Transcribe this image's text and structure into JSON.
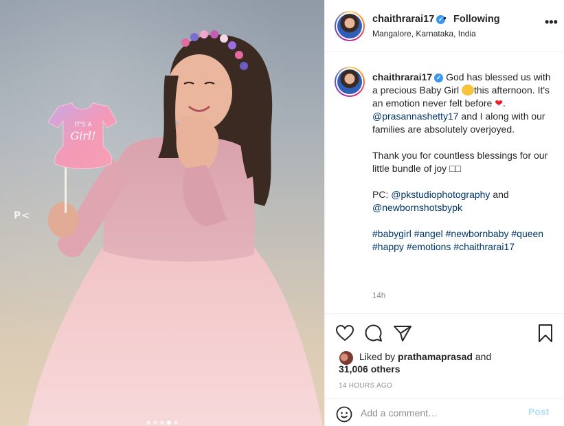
{
  "account": {
    "username": "chaithrarai17",
    "verified_mark": "✓",
    "separator": "•",
    "follow_status": "Following",
    "location": "Mangalore, Karnataka, India",
    "more_label": "•••"
  },
  "photo": {
    "onesie_line1": "IT'S A",
    "onesie_line2": "Girl!",
    "watermark": "P<",
    "carousel_count": 5,
    "carousel_active": 4
  },
  "caption": {
    "username": "chaithrarai17",
    "line1_a": "God has blessed us with a precious Baby Girl",
    "line1_b": "this afternoon. It's an emotion never felt before",
    "line1_end": ".",
    "heart": "❤",
    "mention1": "@prasannashetty17",
    "line2": "and I along with our families are absolutely overjoyed.",
    "line3": "Thank you for countless blessings for our little bundle of joy □□",
    "pc_label": "PC:",
    "mention2": "@pkstudiophotography",
    "and_word": "and",
    "mention3": "@newbornshotsbypk",
    "hashtags": "#babygirl #angel #newbornbaby #queen #happy #emotions #chaithrarai17",
    "age": "14h"
  },
  "actions": {
    "like_icon": "heart-outline-icon",
    "comment_icon": "speech-bubble-icon",
    "share_icon": "paper-plane-icon",
    "save_icon": "bookmark-icon"
  },
  "likes": {
    "prefix": "Liked by",
    "liker": "prathamaprasad",
    "and_word": "and",
    "others": "31,006 others"
  },
  "posted_time": "14 HOURS AGO",
  "comment": {
    "placeholder": "Add a comment…",
    "post_label": "Post"
  },
  "colors": {
    "link": "#00376b",
    "verified": "#3897f0",
    "muted": "#8e8e8e",
    "post_disabled": "#b2dffc",
    "heart": "#ed1c24"
  }
}
